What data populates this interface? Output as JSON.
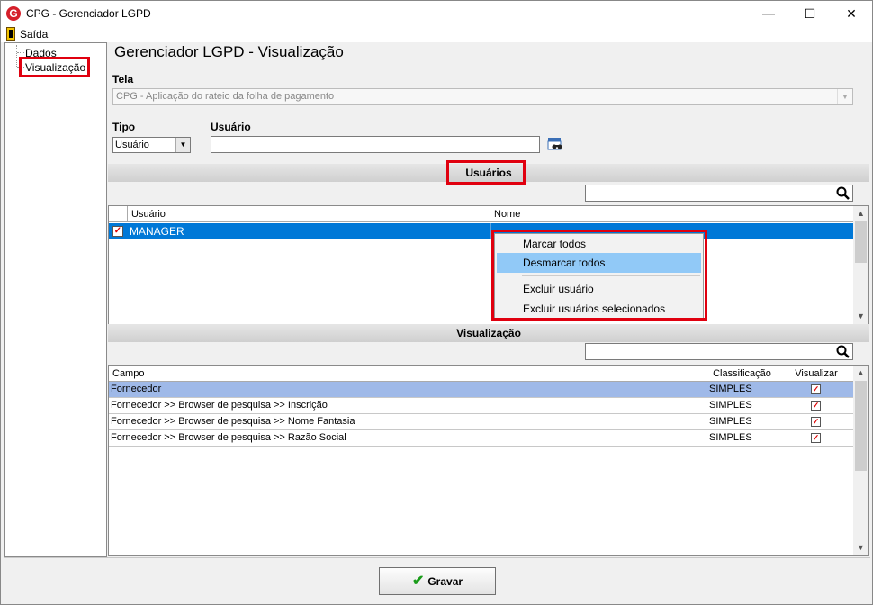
{
  "window": {
    "title": "CPG - Gerenciador LGPD",
    "icon_letter": "G"
  },
  "menu": {
    "exit": "Saída"
  },
  "tree": {
    "items": [
      "Dados",
      "Visualização"
    ]
  },
  "page_title": "Gerenciador LGPD - Visualização",
  "tela": {
    "label": "Tela",
    "value": "CPG - Aplicação do rateio da folha de pagamento"
  },
  "tipo": {
    "label": "Tipo",
    "value": "Usuário"
  },
  "usuario": {
    "label": "Usuário",
    "value": ""
  },
  "sections": {
    "usuarios": "Usuários",
    "visualizacao": "Visualização"
  },
  "users_grid": {
    "headers": [
      "Usuário",
      "Nome"
    ],
    "rows": [
      {
        "checked": true,
        "usuario": "MANAGER",
        "nome": ""
      }
    ]
  },
  "context_menu": [
    "Marcar todos",
    "Desmarcar todos",
    "Excluir usuário",
    "Excluir usuários selecionados"
  ],
  "vis_grid": {
    "headers": [
      "Campo",
      "Classificação",
      "Visualizar"
    ],
    "rows": [
      {
        "campo": "Fornecedor",
        "classificacao": "SIMPLES",
        "visualizar": true
      },
      {
        "campo": "Fornecedor >> Browser de pesquisa >> Inscrição",
        "classificacao": "SIMPLES",
        "visualizar": true
      },
      {
        "campo": "Fornecedor >> Browser de pesquisa >> Nome Fantasia",
        "classificacao": "SIMPLES",
        "visualizar": true
      },
      {
        "campo": "Fornecedor >> Browser de pesquisa >> Razão Social",
        "classificacao": "SIMPLES",
        "visualizar": true
      }
    ]
  },
  "buttons": {
    "gravar": "Gravar"
  },
  "colors": {
    "highlight_red": "#e0000f",
    "selection_blue": "#0078d7",
    "menu_hover": "#91c9f7",
    "row_selected": "#9fb9e8"
  },
  "icons": [
    "app-logo-icon",
    "exit-door-icon",
    "binoculars-icon",
    "search-icon",
    "checkmark-icon"
  ]
}
